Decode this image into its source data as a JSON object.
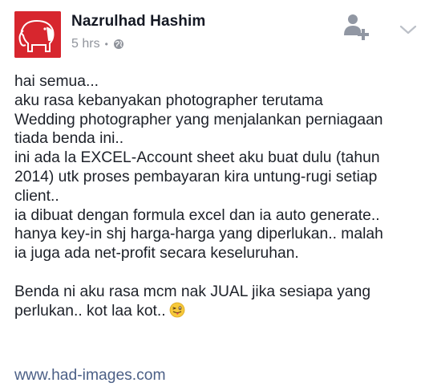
{
  "post": {
    "author": "Nazrulhad Hashim",
    "time": "5 hrs",
    "separator": "•",
    "privacy_icon": "globe-icon",
    "lines": [
      "hai semua...",
      "aku rasa kebanyakan photographer terutama",
      "Wedding photographer yang menjalankan perniagaan",
      "tiada benda ini..",
      "ini ada la EXCEL-Account sheet aku buat dulu (tahun",
      "2014) utk proses pembayaran kira untung-rugi setiap",
      "client..",
      "ia dibuat dengan formula excel dan ia auto generate..",
      "hanya key-in shj harga-harga yang diperlukan.. malah",
      "ia juga ada net-profit secara keseluruhan."
    ],
    "para2_line1": "Benda ni aku rasa mcm nak JUAL jika sesiapa yang",
    "para2_line2": "perlukan.. kot laa kot..",
    "emoji": "winking-tongue-emoji",
    "link": "www.had-images.com"
  },
  "colors": {
    "avatar_bg": "#d7262e",
    "link": "#4b5f86",
    "meta": "#90949c",
    "text": "#1d2129"
  }
}
